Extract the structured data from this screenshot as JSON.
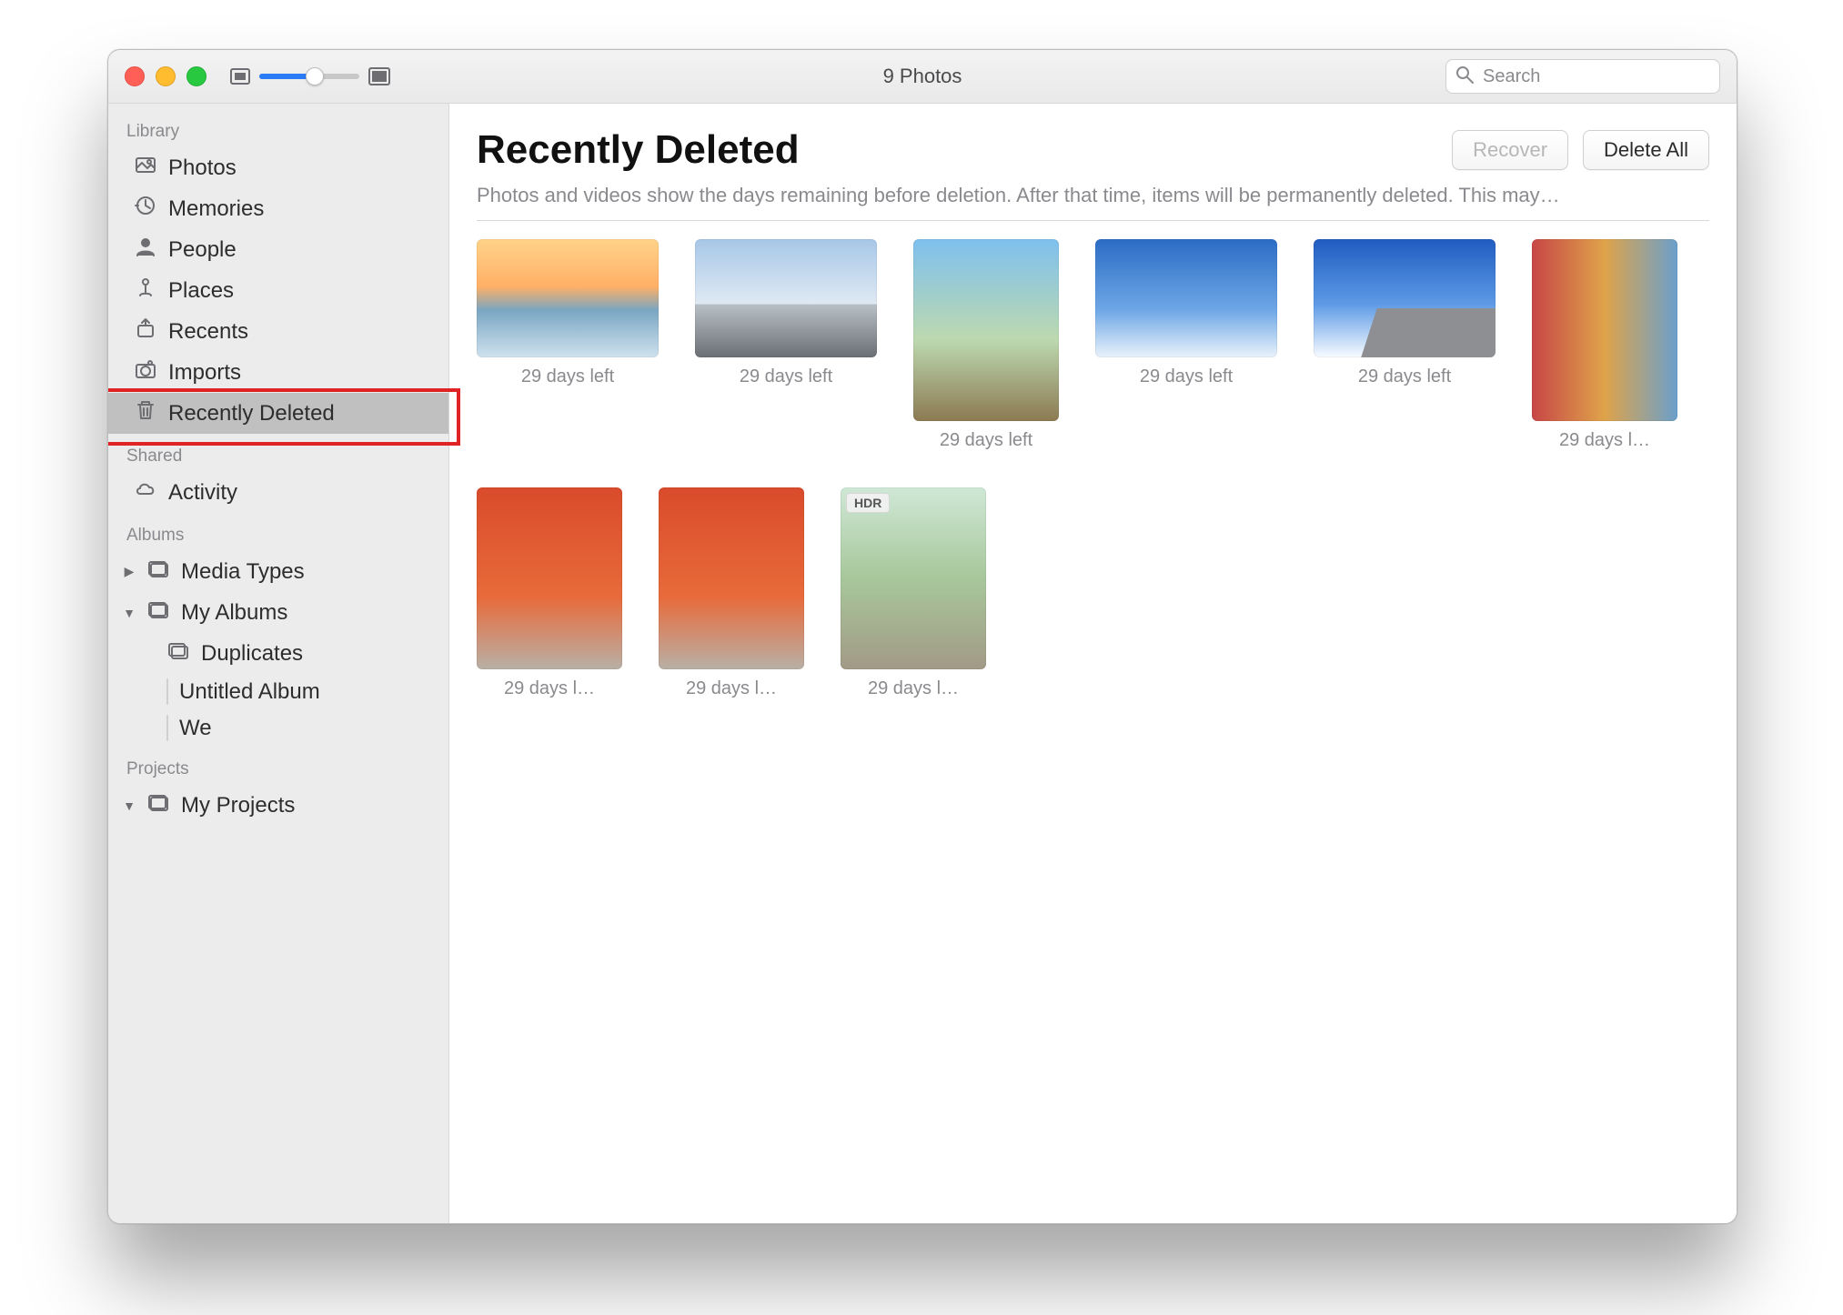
{
  "window": {
    "title": "9 Photos"
  },
  "search": {
    "placeholder": "Search"
  },
  "sidebar": {
    "sections": {
      "library": {
        "title": "Library",
        "items": [
          {
            "label": "Photos",
            "icon": "photos"
          },
          {
            "label": "Memories",
            "icon": "memories"
          },
          {
            "label": "People",
            "icon": "people"
          },
          {
            "label": "Places",
            "icon": "places"
          },
          {
            "label": "Recents",
            "icon": "recents"
          },
          {
            "label": "Imports",
            "icon": "imports"
          },
          {
            "label": "Recently Deleted",
            "icon": "trash",
            "selected": true
          }
        ]
      },
      "shared": {
        "title": "Shared",
        "items": [
          {
            "label": "Activity",
            "icon": "cloud"
          }
        ]
      },
      "albums": {
        "title": "Albums",
        "items": [
          {
            "label": "Media Types",
            "icon": "album-group",
            "caret": "right"
          },
          {
            "label": "My Albums",
            "icon": "album-group",
            "caret": "down",
            "children": [
              {
                "label": "Duplicates",
                "icon": "album-stack"
              },
              {
                "label": "Untitled Album",
                "icon": "swatch"
              },
              {
                "label": "We",
                "icon": "swatch"
              }
            ]
          }
        ]
      },
      "projects": {
        "title": "Projects",
        "items": [
          {
            "label": "My Projects",
            "icon": "album-group",
            "caret": "down"
          }
        ]
      }
    }
  },
  "main": {
    "heading": "Recently Deleted",
    "subtitle": "Photos and videos show the days remaining before deletion. After that time, items will be permanently deleted. This may…",
    "buttons": {
      "recover": "Recover",
      "delete_all": "Delete All"
    },
    "items": [
      {
        "caption": "29 days left",
        "orientation": "land",
        "style": "sunset"
      },
      {
        "caption": "29 days left",
        "orientation": "land",
        "style": "mountains"
      },
      {
        "caption": "29 days left",
        "orientation": "port",
        "style": "vineyard"
      },
      {
        "caption": "29 days left",
        "orientation": "land",
        "style": "sky1"
      },
      {
        "caption": "29 days left",
        "orientation": "land",
        "style": "sky2"
      },
      {
        "caption": "29 days l…",
        "orientation": "port",
        "style": "mural"
      },
      {
        "caption": "29 days l…",
        "orientation": "port",
        "style": "cafe"
      },
      {
        "caption": "29 days l…",
        "orientation": "port",
        "style": "cafe"
      },
      {
        "caption": "29 days l…",
        "orientation": "port",
        "style": "palm",
        "badge": "HDR"
      }
    ]
  }
}
